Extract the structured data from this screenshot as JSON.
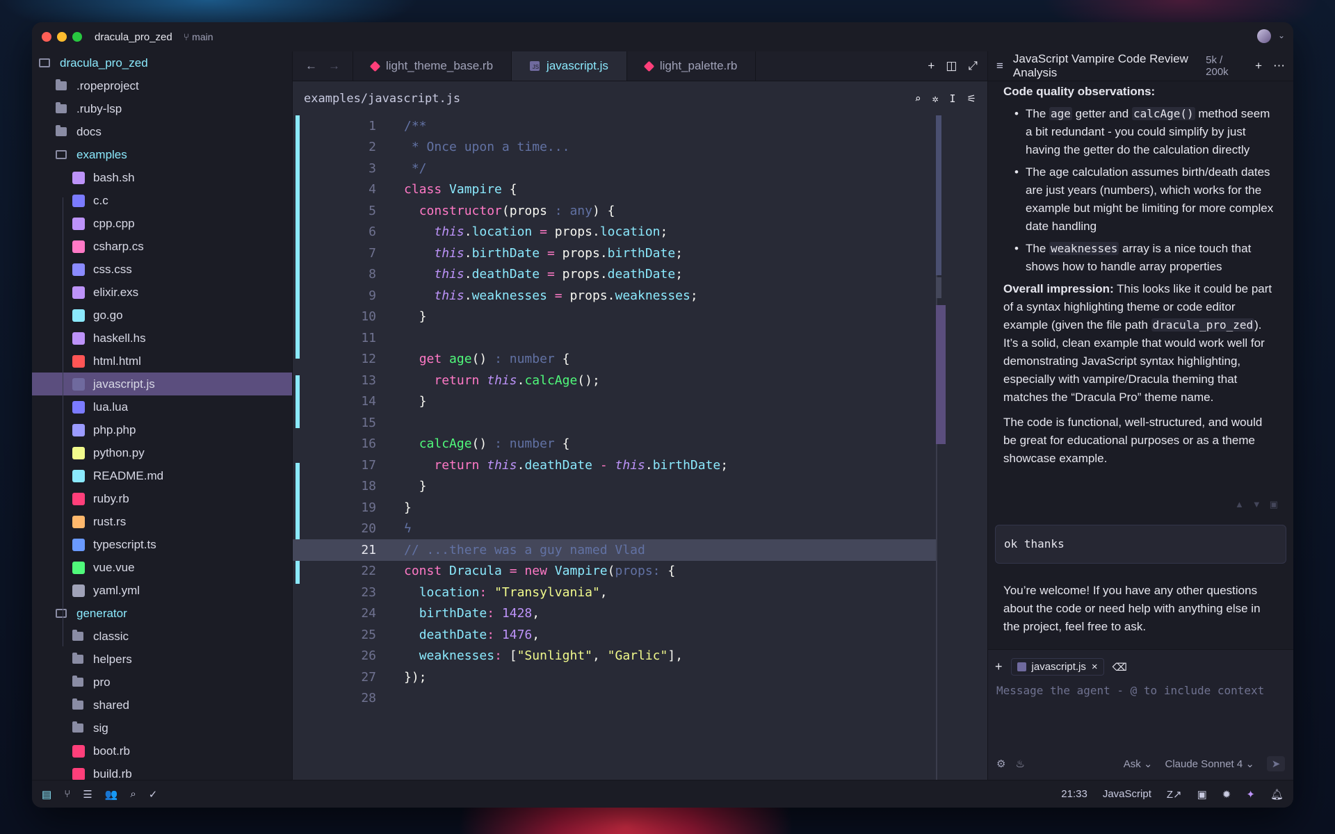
{
  "window": {
    "project": "dracula_pro_zed",
    "branch": "main"
  },
  "sidebar": {
    "root": "dracula_pro_zed",
    "items": [
      {
        "label": ".ropeproject",
        "kind": "folder",
        "depth": 1
      },
      {
        "label": ".ruby-lsp",
        "kind": "folder",
        "depth": 1
      },
      {
        "label": "docs",
        "kind": "folder",
        "depth": 1
      },
      {
        "label": "examples",
        "kind": "folder-open",
        "depth": 1
      },
      {
        "label": "bash.sh",
        "kind": "file",
        "icon": "terminal-icon",
        "color": "#bd93f9",
        "depth": 2
      },
      {
        "label": "c.c",
        "kind": "file",
        "icon": "c-icon",
        "color": "#7b7bff",
        "depth": 2
      },
      {
        "label": "cpp.cpp",
        "kind": "file",
        "icon": "cpp-icon",
        "color": "#bd93f9",
        "depth": 2
      },
      {
        "label": "csharp.cs",
        "kind": "file",
        "icon": "csharp-icon",
        "color": "#ff79c6",
        "depth": 2
      },
      {
        "label": "css.css",
        "kind": "file",
        "icon": "css-icon",
        "color": "#8b8bff",
        "depth": 2
      },
      {
        "label": "elixir.exs",
        "kind": "file",
        "icon": "elixir-icon",
        "color": "#bd93f9",
        "depth": 2
      },
      {
        "label": "go.go",
        "kind": "file",
        "icon": "go-icon",
        "color": "#8be9fd",
        "depth": 2
      },
      {
        "label": "haskell.hs",
        "kind": "file",
        "icon": "haskell-icon",
        "color": "#bd93f9",
        "depth": 2
      },
      {
        "label": "html.html",
        "kind": "file",
        "icon": "html-icon",
        "color": "#ff5555",
        "depth": 2
      },
      {
        "label": "javascript.js",
        "kind": "file",
        "icon": "javascript-icon",
        "color": "#6f6a9e",
        "depth": 2,
        "selected": true
      },
      {
        "label": "lua.lua",
        "kind": "file",
        "icon": "lua-icon",
        "color": "#7b7bff",
        "depth": 2
      },
      {
        "label": "php.php",
        "kind": "file",
        "icon": "php-icon",
        "color": "#9b9bff",
        "depth": 2
      },
      {
        "label": "python.py",
        "kind": "file",
        "icon": "python-icon",
        "color": "#f1fa8c",
        "depth": 2
      },
      {
        "label": "README.md",
        "kind": "file",
        "icon": "markdown-icon",
        "color": "#8be9fd",
        "depth": 2
      },
      {
        "label": "ruby.rb",
        "kind": "file",
        "icon": "ruby-icon",
        "color": "#ff3f7a",
        "depth": 2
      },
      {
        "label": "rust.rs",
        "kind": "file",
        "icon": "rust-icon",
        "color": "#ffb86c",
        "depth": 2
      },
      {
        "label": "typescript.ts",
        "kind": "file",
        "icon": "typescript-icon",
        "color": "#6a9aff",
        "depth": 2
      },
      {
        "label": "vue.vue",
        "kind": "file",
        "icon": "vue-icon",
        "color": "#50fa7b",
        "depth": 2
      },
      {
        "label": "yaml.yml",
        "kind": "file",
        "icon": "gear-icon",
        "color": "#a0a2b8",
        "depth": 2
      },
      {
        "label": "generator",
        "kind": "folder-open",
        "depth": 1
      },
      {
        "label": "classic",
        "kind": "folder",
        "depth": 2
      },
      {
        "label": "helpers",
        "kind": "folder",
        "depth": 2
      },
      {
        "label": "pro",
        "kind": "folder",
        "depth": 2
      },
      {
        "label": "shared",
        "kind": "folder",
        "depth": 2
      },
      {
        "label": "sig",
        "kind": "folder",
        "depth": 2
      },
      {
        "label": "boot.rb",
        "kind": "file",
        "icon": "ruby-icon",
        "color": "#ff3f7a",
        "depth": 2
      },
      {
        "label": "build.rb",
        "kind": "file",
        "icon": "ruby-icon",
        "color": "#ff3f7a",
        "depth": 2
      }
    ]
  },
  "editor": {
    "tabs": [
      {
        "label": "light_theme_base.rb",
        "icon": "ruby-icon",
        "active": false
      },
      {
        "label": "javascript.js",
        "icon": "javascript-icon",
        "active": true
      },
      {
        "label": "light_palette.rb",
        "icon": "ruby-icon",
        "active": false
      }
    ],
    "path": "examples/javascript.js",
    "current_line": 21,
    "line_numbers": [
      "1",
      "2",
      "3",
      "4",
      "5",
      "6",
      "7",
      "8",
      "9",
      "10",
      "11",
      "12",
      "13",
      "14",
      "15",
      "16",
      "17",
      "18",
      "19",
      "20",
      "21",
      "22",
      "23",
      "24",
      "25",
      "26",
      "27",
      "28"
    ]
  },
  "agent": {
    "title": "JavaScript Vampire Code Review Analysis",
    "tokens": "5k / 200k",
    "heading": "Code quality observations:",
    "bullet1_a": "The ",
    "bullet1_code1": "age",
    "bullet1_b": " getter and ",
    "bullet1_code2": "calcAge()",
    "bullet1_c": " method seem a bit redundant - you could simplify by just having the getter do the calculation directly",
    "bullet2": "The age calculation assumes birth/death dates are just years (numbers), which works for the example but might be limiting for more complex date handling",
    "bullet3_a": "The ",
    "bullet3_code": "weaknesses",
    "bullet3_b": " array is a nice touch that shows how to handle array properties",
    "overall_label": "Overall impression:",
    "overall_a": " This looks like it could be part of a syntax highlighting theme or code editor example (given the file path ",
    "overall_code": "dracula_pro_zed",
    "overall_b": "). It’s a solid, clean example that would work well for demonstrating JavaScript syntax highlighting, especially with vampire/Dracula theming that matches the “Dracula Pro” theme name.",
    "closing": "The code is functional, well-structured, and would be great for educational purposes or as a theme showcase example.",
    "user_message": "ok thanks",
    "reply": "You’re welcome! If you have any other questions about the code or need help with anything else in the project, feel free to ask.",
    "context_chip": "javascript.js",
    "placeholder": "Message the agent - @ to include context",
    "mode": "Ask",
    "model": "Claude Sonnet 4"
  },
  "status": {
    "cursor": "21:33",
    "language": "JavaScript"
  },
  "colors": {
    "accent": "#8be9fd",
    "selection": "#5b4e7e",
    "pink": "#ff79c6",
    "green": "#50fa7b",
    "purple": "#bd93f9",
    "yellow": "#f1fa8c",
    "comment": "#6272a4"
  }
}
